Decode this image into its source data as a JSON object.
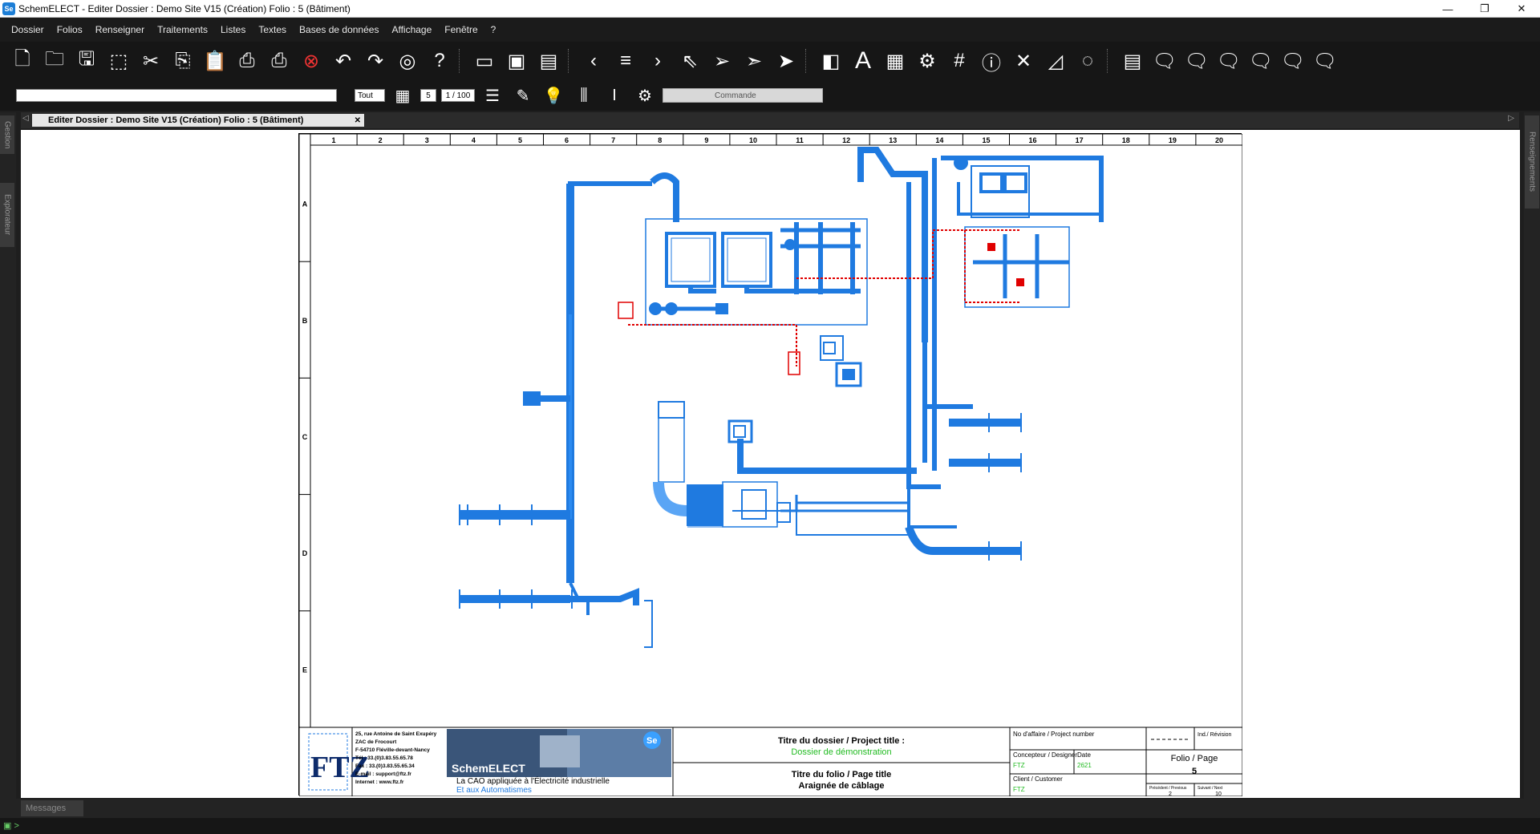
{
  "window": {
    "title": "SchemELECT - Editer  Dossier : Demo Site V15  (Création)  Folio : 5  (Bâtiment)",
    "app_icon": "Se"
  },
  "menu": [
    "Dossier",
    "Folios",
    "Renseigner",
    "Traitements",
    "Listes",
    "Textes",
    "Bases de données",
    "Affichage",
    "Fenêtre",
    "?"
  ],
  "toolbar2": {
    "filter_value": "Tout",
    "layer_number": "5",
    "scale": "1 / 100",
    "command_placeholder": "Commande"
  },
  "doc_tab": {
    "label": "Editer  Dossier : Demo Site V15  (Création)  Folio : 5  (Bâtiment)"
  },
  "side_tabs": {
    "left_top": "Gestion",
    "left_bottom": "Explorateur",
    "right": "Renseignements"
  },
  "status": {
    "messages_tab": "Messages"
  },
  "sheet": {
    "columns": [
      "1",
      "2",
      "3",
      "4",
      "5",
      "6",
      "7",
      "8",
      "9",
      "10",
      "11",
      "12",
      "13",
      "14",
      "15",
      "16",
      "17",
      "18",
      "19",
      "20"
    ],
    "rows": [
      "A",
      "B",
      "C",
      "D",
      "E"
    ]
  },
  "title_block": {
    "company_logo": "FTZ",
    "address": [
      "25, rue Antoine de Saint Exupéry",
      "ZAC de Frocourt",
      "F-54710 Fléville-devant-Nancy",
      "Tél : 33.(0)3.83.55.65.78",
      "Fax : 33.(0)3.83.55.65.34",
      "E-mail : support@ftz.fr",
      "Internet : www.ftz.fr"
    ],
    "product_name": "SchemELECT",
    "product_badge": "Se",
    "tagline_1": "La CAO appliquée à l'Électricité industrielle",
    "tagline_2": "Et aux Automatismes",
    "project_title_label": "Titre du dossier / Project title :",
    "project_title_value": "Dossier de démonstration",
    "folio_title_label": "Titre du folio / Page title",
    "folio_title_value": "Araignée de câblage",
    "affair_label": "No d'affaire / Project number",
    "revision_label": "Ind./ Révision",
    "designer_label": "Concepteur / Designer",
    "designer_value": "FTZ",
    "date_label": "Date",
    "date_value": "2621",
    "folio_label": "Folio / Page",
    "folio_value": "5",
    "client_label": "Client / Customer",
    "client_value": "FTZ",
    "previous_label": "Précédent / Previous",
    "previous_value": "2",
    "next_label": "Suivant / Next",
    "next_value": "10"
  },
  "colors": {
    "ducts": "#1f7ae0",
    "wiring": "#e00000",
    "accent_green": "#22bb22"
  }
}
